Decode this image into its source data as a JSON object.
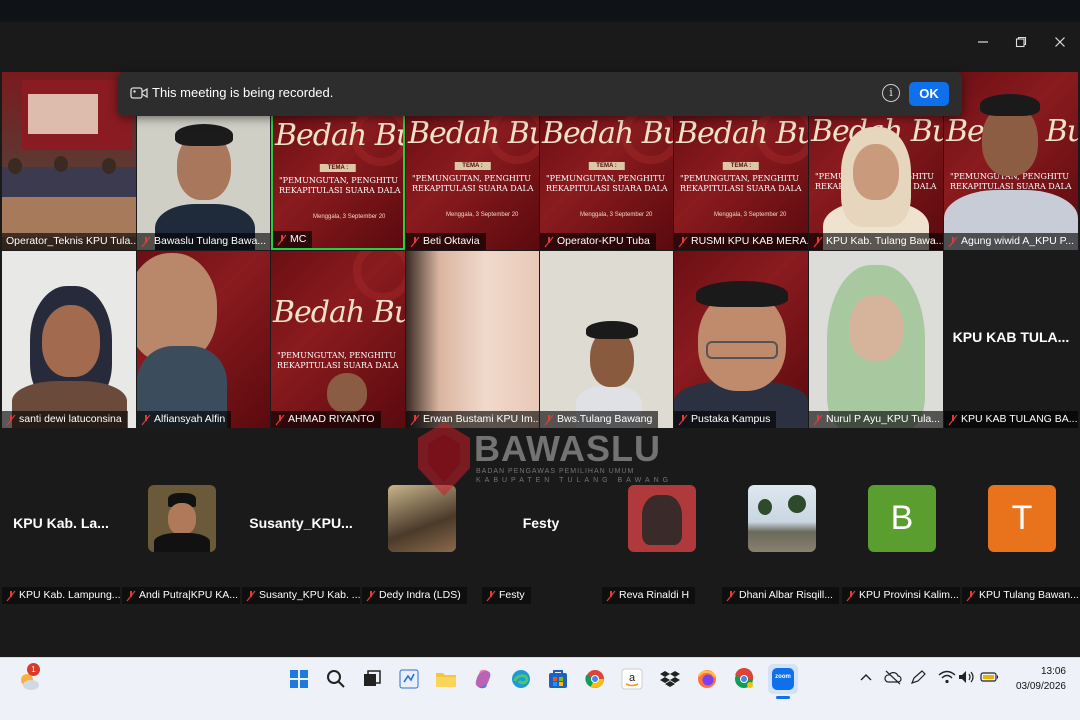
{
  "window": {
    "minimize_icon": "minimize-icon",
    "restore_icon": "restore-icon",
    "close_icon": "close-icon"
  },
  "recording_banner": {
    "message": "This meeting is being recorded.",
    "ok_label": "OK",
    "info_icon": "info-icon",
    "info_glyph": "i"
  },
  "slide": {
    "title": "Bedah Bu",
    "tema": "TEMA :",
    "quote_line1": "\"PEMUNGUTAN, PENGHITU",
    "quote_line2": "REKAPITULASI SUARA DALA",
    "date": "Menggala, 3 September 20"
  },
  "row1": [
    {
      "name": "Operator_Teknis KPU Tula...",
      "kind": "room"
    },
    {
      "name": "Bawaslu Tulang Bawa...",
      "kind": "person"
    },
    {
      "name": "MC",
      "kind": "slide",
      "active": true
    },
    {
      "name": "Beti Oktavia",
      "kind": "slide"
    },
    {
      "name": "Operator-KPU Tuba",
      "kind": "slide"
    },
    {
      "name": "RUSMI KPU KAB MERA...",
      "kind": "slide"
    },
    {
      "name": "KPU Kab. Tulang Bawa...",
      "kind": "slide-person"
    },
    {
      "name": "Agung wiwid A_KPU P...",
      "kind": "slide-person"
    }
  ],
  "row2": [
    {
      "name": "santi dewi latuconsina",
      "kind": "person"
    },
    {
      "name": "Alfiansyah Alfin",
      "kind": "person"
    },
    {
      "name": "AHMAD RIYANTO",
      "kind": "slide"
    },
    {
      "name": "Erwan Bustami KPU Im...",
      "kind": "person"
    },
    {
      "name": "Bws.Tulang Bawang",
      "kind": "person"
    },
    {
      "name": "Pustaka Kampus",
      "kind": "person"
    },
    {
      "name": "Nurul P Ayu_KPU Tula...",
      "kind": "person"
    },
    {
      "name": "KPU KAB TULANG BA...",
      "kind": "text",
      "display": "KPU KAB TULA..."
    }
  ],
  "row3": [
    {
      "name": "KPU Kab. Lampung...",
      "kind": "text",
      "display": "KPU Kab. La..."
    },
    {
      "name": "Andi Putra|KPU KA...",
      "kind": "photo"
    },
    {
      "name": "Susanty_KPU Kab. ...",
      "kind": "text",
      "display": "Susanty_KPU..."
    },
    {
      "name": "Dedy Indra (LDS)",
      "kind": "photo"
    },
    {
      "name": "Festy",
      "kind": "text",
      "display": "Festy"
    },
    {
      "name": "Reva Rinaldi H",
      "kind": "photo"
    },
    {
      "name": "Dhani Albar Risqill...",
      "kind": "photo"
    },
    {
      "name": "KPU Provinsi Kalim...",
      "kind": "letter",
      "letter": "B",
      "color": "#5a9e2f"
    },
    {
      "name": "KPU Tulang Bawan...",
      "kind": "letter",
      "letter": "T",
      "color": "#e8731c"
    }
  ],
  "watermark": {
    "title": "BAWASLU",
    "subtitle": "BADAN PENGAWAS PEMILIHAN UMUM",
    "subtitle2": "KABUPATEN TULANG BAWANG"
  },
  "taskbar": {
    "weather_badge": "1",
    "time": "13:06",
    "date": "03/09/2026",
    "apps": [
      "start-icon",
      "search-icon",
      "task-view-icon",
      "widgets-icon",
      "file-explorer-icon",
      "copilot-icon",
      "edge-icon",
      "store-icon",
      "chrome-icon",
      "amazon-icon",
      "dropbox-icon",
      "firefox-icon",
      "chrome-alt-icon",
      "zoom-icon"
    ],
    "zoom_label": "zoom"
  },
  "colors": {
    "zoom_blue": "#0e71eb",
    "slide_red": "#7a1418",
    "active_border": "#2ecc40"
  }
}
